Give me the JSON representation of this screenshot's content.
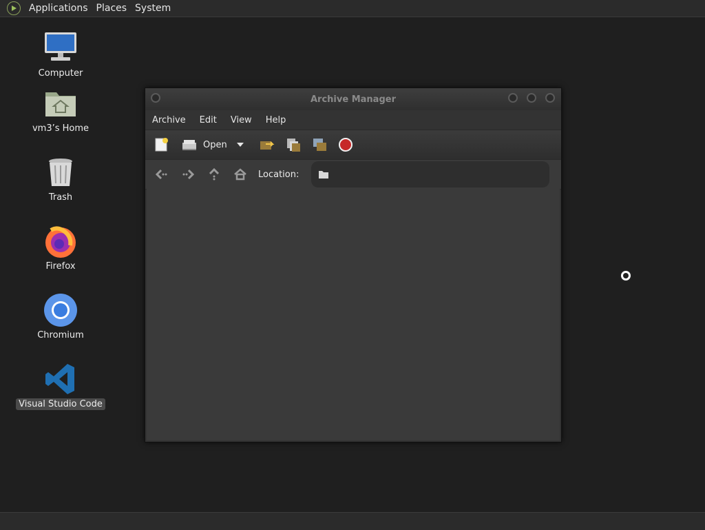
{
  "top_panel": {
    "menus": [
      "Applications",
      "Places",
      "System"
    ]
  },
  "desktop": {
    "icons": [
      {
        "label": "Computer",
        "icon": "computer-icon"
      },
      {
        "label": "vm3’s Home",
        "icon": "home-folder-icon"
      },
      {
        "label": "Trash",
        "icon": "trash-icon"
      },
      {
        "label": "Firefox",
        "icon": "firefox-icon"
      },
      {
        "label": "Chromium",
        "icon": "chromium-icon"
      },
      {
        "label": "Visual Studio Code",
        "icon": "vscode-icon",
        "selected": true
      }
    ]
  },
  "window": {
    "title": "Archive Manager",
    "menus": [
      "Archive",
      "Edit",
      "View",
      "Help"
    ],
    "toolbar": {
      "open_label": "Open"
    },
    "location": {
      "label": "Location:",
      "value": ""
    }
  },
  "colors": {
    "desktop_bg": "#1f1f1f",
    "panel_bg": "#2b2b2b",
    "window_bg": "#333333",
    "stop_red": "#c62828"
  }
}
